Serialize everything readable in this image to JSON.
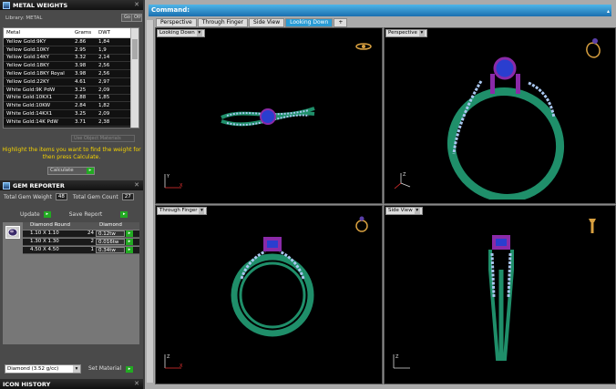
{
  "metal_weights": {
    "title": "METAL WEIGHTS",
    "library_label": "Library: METAL",
    "gold_button": "Go",
    "other_button": "Othe",
    "columns": [
      "Metal",
      "Grams",
      "DWT"
    ],
    "rows": [
      [
        "Yellow Gold:9KY",
        "2.86",
        "1,84"
      ],
      [
        "Yellow Gold:10KY",
        "2.95",
        "1,9"
      ],
      [
        "Yellow Gold:14KY",
        "3.32",
        "2,14"
      ],
      [
        "Yellow Gold:18KY",
        "3.98",
        "2,56"
      ],
      [
        "Yellow Gold:18KY Royal",
        "3.98",
        "2,56"
      ],
      [
        "Yellow Gold:22KY",
        "4.61",
        "2,97"
      ],
      [
        "White Gold:9K PdW",
        "3.25",
        "2,09"
      ],
      [
        "White Gold:10KX1",
        "2.88",
        "1,85"
      ],
      [
        "White Gold:10KW",
        "2.84",
        "1,82"
      ],
      [
        "White Gold:14KX1",
        "3.25",
        "2,09"
      ],
      [
        "White Gold:14K PdW",
        "3.71",
        "2,38"
      ],
      [
        "White Gold:18KPdW",
        "3.98",
        "2,56"
      ]
    ],
    "use_object_materials": "Use Object Materials",
    "hint": "Highlight the items you want to find the weight for then press Calculate.",
    "calculate_label": "Calculate"
  },
  "gem_reporter": {
    "title": "GEM REPORTER",
    "total_gem_weight_label": "Total Gem Weight",
    "total_gem_weight": "48",
    "total_gem_count_label": "Total Gem Count",
    "total_gem_count": "27",
    "update_label": "Update",
    "save_report_label": "Save Report",
    "header_shape": "Diamond Round",
    "header_material": "Diamond",
    "rows": [
      {
        "size": "1.10 X 1.10",
        "count": "24",
        "weight": "0.12tw"
      },
      {
        "size": "1.30 X 1.30",
        "count": "2",
        "weight": "0.016tw"
      },
      {
        "size": "4.50 X 4.50",
        "count": "1",
        "weight": "0.34tw"
      }
    ],
    "go_label": "▸",
    "material_value": "Diamond    (3.52 g/cc)",
    "set_material_label": "Set Material"
  },
  "icon_history": {
    "title": "ICON HISTORY"
  },
  "command": {
    "label": "Command:"
  },
  "tabs": [
    "Perspective",
    "Through Finger",
    "Side View",
    "Looking Down"
  ],
  "active_tab": 3,
  "viewports": {
    "top_left": "Looking Down",
    "top_right": "Perspective",
    "bottom_left": "Through Finger",
    "bottom_right": "Side View"
  },
  "colors": {
    "accent": "#2a9cd5",
    "band": "#1f8f6a",
    "prong": "#8a2aa8",
    "gem": "#2a3ecf",
    "hint": "#f5d300"
  },
  "icons": [
    "close-icon",
    "panel-icon",
    "ring-icon",
    "axes-icon",
    "dropdown-icon"
  ]
}
